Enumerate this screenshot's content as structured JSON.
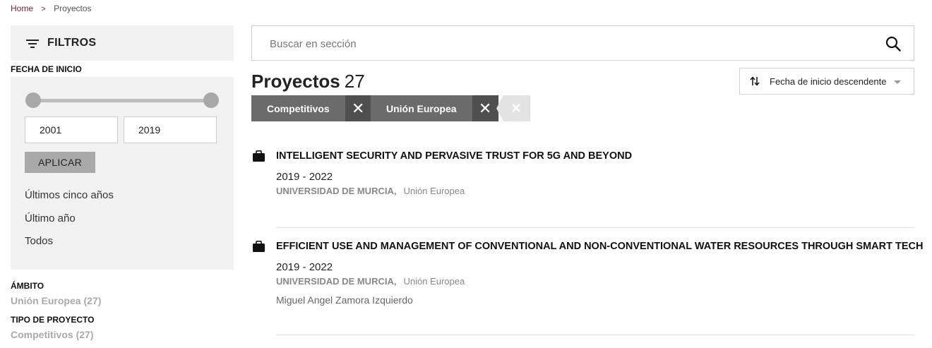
{
  "breadcrumb": {
    "home": "Home",
    "separator": ">",
    "current": "Proyectos"
  },
  "sidebar": {
    "title": "FILTROS",
    "date_section": {
      "label": "FECHA DE INICIO",
      "from": "2001",
      "to": "2019",
      "apply_label": "APLICAR",
      "ranges": [
        "Últimos cinco años",
        "Último año",
        "Todos"
      ]
    },
    "scope_section": {
      "label": "ÁMBITO",
      "facet": "Unión Europea",
      "count": "(27)"
    },
    "type_section": {
      "label": "TIPO DE PROYECTO",
      "facet": "Competitivos",
      "count": "(27)"
    }
  },
  "search": {
    "placeholder": "Buscar en sección"
  },
  "results": {
    "title": "Proyectos",
    "count": "27"
  },
  "sort": {
    "label": "Fecha de inicio descendente"
  },
  "active_filters": [
    {
      "label": "Competitivos"
    },
    {
      "label": "Unión Europea"
    }
  ],
  "projects": [
    {
      "title": "INTELLIGENT SECURITY AND PERVASIVE TRUST FOR 5G AND BEYOND",
      "years": "2019 - 2022",
      "org": "UNIVERSIDAD DE MURCIA,",
      "scope": "Unión Europea",
      "person": ""
    },
    {
      "title": "EFFICIENT USE AND MANAGEMENT OF CONVENTIONAL AND NON-CONVENTIONAL WATER RESOURCES THROUGH SMART TECH",
      "years": "2019 - 2022",
      "org": "UNIVERSIDAD DE MURCIA,",
      "scope": "Unión Europea",
      "person": "Miguel Angel Zamora Izquierdo"
    }
  ],
  "icons": {
    "filter": "filter-lines-icon",
    "search": "magnifier-icon",
    "sort": "sort-arrows-icon",
    "project": "briefcase-icon",
    "remove": "close-icon"
  },
  "colors": {
    "accent": "#8a1c2c",
    "chip": "#6b6b6b",
    "chip_x": "#4f4f4f",
    "panel": "#f2f2f2"
  }
}
